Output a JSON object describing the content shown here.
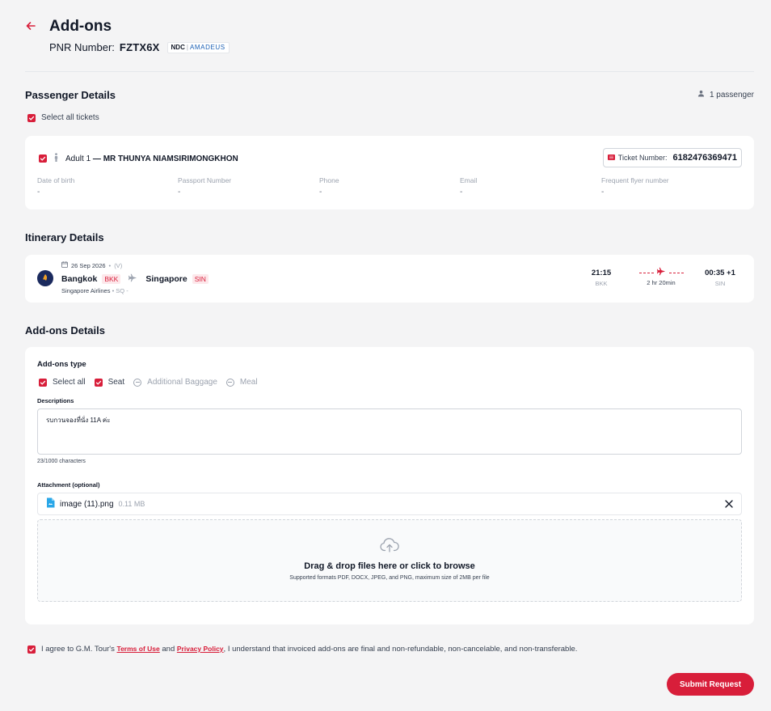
{
  "header": {
    "title": "Add-ons",
    "pnr_label": "PNR Number:",
    "pnr_value": "FZTX6X",
    "ndc_label": "NDC",
    "gds_label": "AMADEUS"
  },
  "passenger_section": {
    "title": "Passenger Details",
    "passenger_count": "1 passenger",
    "select_all_label": "Select all tickets",
    "passenger": {
      "type_label": "Adult 1",
      "name": "MR THUNYA NIAMSIRIMONGKHON",
      "ticket_label": "Ticket Number:",
      "ticket_number": "6182476369471",
      "fields": [
        {
          "label": "Date of birth",
          "value": "-"
        },
        {
          "label": "Passport Number",
          "value": "-"
        },
        {
          "label": "Phone",
          "value": "-"
        },
        {
          "label": "Email",
          "value": "-"
        },
        {
          "label": "Frequent flyer number",
          "value": "-"
        }
      ]
    }
  },
  "itinerary_section": {
    "title": "Itinerary Details",
    "date": "26 Sep 2026",
    "booking_class": "(V)",
    "origin_city": "Bangkok",
    "origin_code": "BKK",
    "destination_city": "Singapore",
    "destination_code": "SIN",
    "airline": "Singapore Airlines",
    "flight_code": "SQ -",
    "depart_time": "21:15",
    "depart_code": "BKK",
    "duration": "2 hr 20min",
    "arrive_time": "00:35 +1",
    "arrive_code": "SIN"
  },
  "addons_section": {
    "title": "Add-ons Details",
    "type_label": "Add-ons type",
    "options": [
      {
        "label": "Select all",
        "checked": true
      },
      {
        "label": "Seat",
        "checked": true
      },
      {
        "label": "Additional Baggage",
        "checked": false
      },
      {
        "label": "Meal",
        "checked": false
      }
    ],
    "description_label": "Descriptions",
    "description_value": "รบกวนจองที่นั่ง 11A ค่ะ",
    "char_count": "23/1000 characters",
    "attachment_label": "Attachment (optional)",
    "file_name": "image (11).png",
    "file_size": "0.11 MB",
    "dropzone_title": "Drag & drop files here or click to browse",
    "dropzone_subtitle": "Supported formats PDF, DOCX, JPEG, and PNG, maximum size of 2MB per file"
  },
  "agreement": {
    "prefix": "I agree to G.M. Tour's",
    "terms_label": "Terms of Use",
    "and_label": "and",
    "privacy_label": "Privacy Policy",
    "suffix": ", I understand that invoiced add-ons are final and non-refundable, non-cancelable, and non-transferable."
  },
  "submit_label": "Submit Request",
  "colors": {
    "accent": "#d81e3a",
    "background": "#f4f4f5",
    "card": "#ffffff"
  },
  "icons": [
    "back-arrow-icon",
    "user-icon",
    "person-icon",
    "ticket-icon",
    "calendar-icon",
    "plane-icon",
    "file-icon",
    "close-icon",
    "upload-cloud-icon",
    "check-icon"
  ]
}
